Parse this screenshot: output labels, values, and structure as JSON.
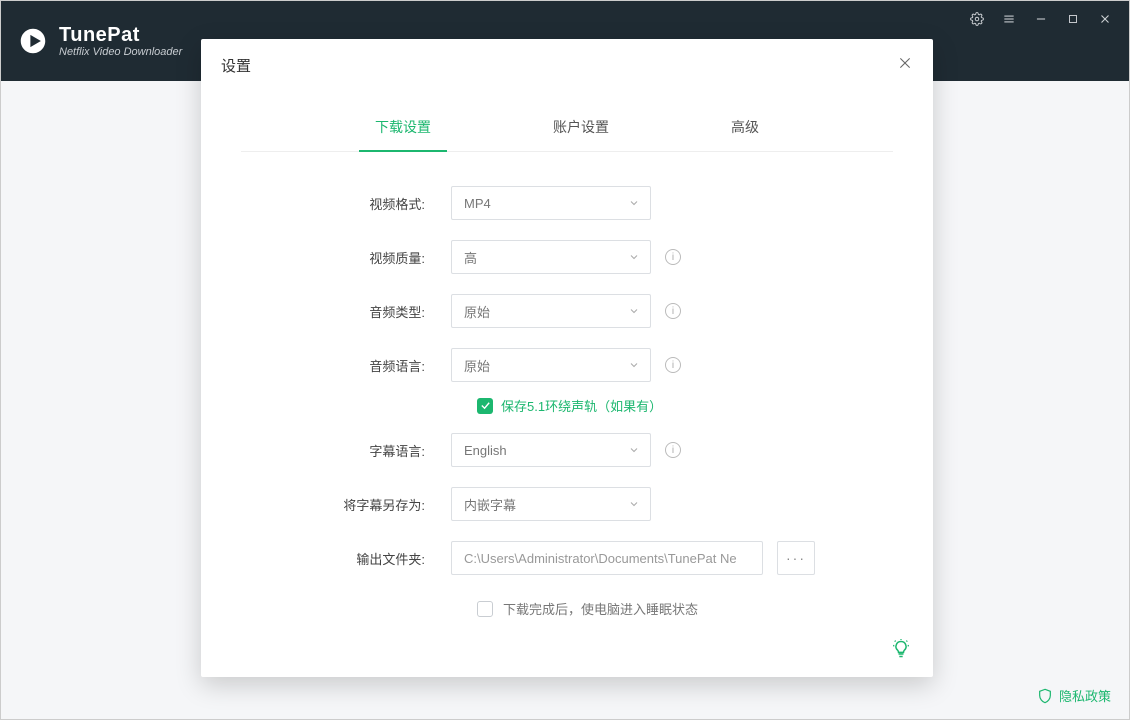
{
  "brand": {
    "title": "TunePat",
    "subtitle": "Netflix Video Downloader"
  },
  "modal": {
    "title": "设置",
    "tabs": {
      "download": "下载设置",
      "account": "账户设置",
      "advanced": "高级"
    },
    "labels": {
      "video_format": "视频格式:",
      "video_quality": "视频质量:",
      "audio_type": "音频类型:",
      "audio_language": "音频语言:",
      "subtitle_language": "字幕语言:",
      "save_subtitle_as": "将字幕另存为:",
      "output_folder": "输出文件夹:"
    },
    "values": {
      "video_format": "MP4",
      "video_quality": "高",
      "audio_type": "原始",
      "audio_language": "原始",
      "subtitle_language": "English",
      "save_subtitle_as": "内嵌字幕",
      "output_folder": "C:\\Users\\Administrator\\Documents\\TunePat Ne"
    },
    "checkboxes": {
      "surround": {
        "checked": true,
        "label": "保存5.1环绕声轨（如果有）"
      },
      "sleep": {
        "checked": false,
        "label": "下载完成后，使电脑进入睡眠状态"
      }
    },
    "browse": "···"
  },
  "footer": {
    "privacy": "隐私政策"
  }
}
